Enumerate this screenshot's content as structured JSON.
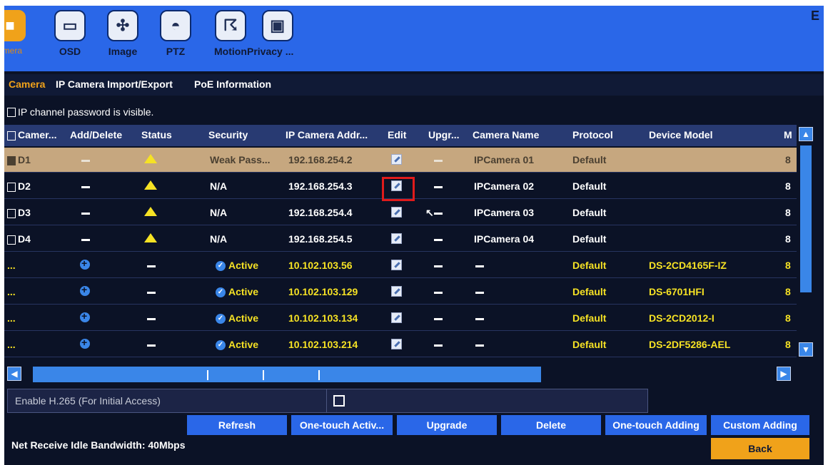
{
  "toolbar": {
    "items": [
      {
        "label": "amera",
        "icon": "camera-icon"
      },
      {
        "label": "OSD",
        "icon": "monitor-icon"
      },
      {
        "label": "Image",
        "icon": "fan-icon"
      },
      {
        "label": "PTZ",
        "icon": "dome-icon"
      },
      {
        "label": "Motion",
        "icon": "running-man-icon"
      },
      {
        "label": "Privacy ...",
        "icon": "privacy-mask-icon"
      }
    ],
    "exit_label": "E"
  },
  "subtabs": [
    "Camera",
    "IP Camera Import/Export",
    "PoE Information"
  ],
  "password_visible_label": "IP channel password is visible.",
  "table": {
    "headers": [
      "Camer...",
      "Add/Delete",
      "Status",
      "Security",
      "IP Camera Addr...",
      "Edit",
      "Upgr...",
      "Camera Name",
      "Protocol",
      "Device Model",
      "M"
    ],
    "rows": [
      {
        "camera": "D1",
        "security": "Weak Pass...",
        "ip": "192.168.254.2",
        "name": "IPCamera 01",
        "protocol": "Default",
        "model": "",
        "m": "8"
      },
      {
        "camera": "D2",
        "security": "N/A",
        "ip": "192.168.254.3",
        "name": "IPCamera 02",
        "protocol": "Default",
        "model": "",
        "m": "8"
      },
      {
        "camera": "D3",
        "security": "N/A",
        "ip": "192.168.254.4",
        "name": "IPCamera 03",
        "protocol": "Default",
        "model": "",
        "m": "8"
      },
      {
        "camera": "D4",
        "security": "N/A",
        "ip": "192.168.254.5",
        "name": "IPCamera 04",
        "protocol": "Default",
        "model": "",
        "m": "8"
      },
      {
        "camera": "...",
        "security": "Active",
        "ip": "10.102.103.56",
        "name": "",
        "protocol": "Default",
        "model": "DS-2CD4165F-IZ",
        "m": "8"
      },
      {
        "camera": "...",
        "security": "Active",
        "ip": "10.102.103.129",
        "name": "",
        "protocol": "Default",
        "model": "DS-6701HFI",
        "m": "8"
      },
      {
        "camera": "...",
        "security": "Active",
        "ip": "10.102.103.134",
        "name": "",
        "protocol": "Default",
        "model": "DS-2CD2012-I",
        "m": "8"
      },
      {
        "camera": "...",
        "security": "Active",
        "ip": "10.102.103.214",
        "name": "",
        "protocol": "Default",
        "model": "DS-2DF5286-AEL",
        "m": "8"
      }
    ]
  },
  "h265_label": "Enable H.265 (For Initial Access)",
  "buttons": {
    "refresh": "Refresh",
    "one_touch_activate": "One-touch Activ...",
    "upgrade": "Upgrade",
    "delete": "Delete",
    "one_touch_adding": "One-touch Adding",
    "custom_adding": "Custom Adding",
    "back": "Back"
  },
  "bandwidth": "Net Receive Idle Bandwidth: 40Mbps",
  "colors": {
    "toolbar": "#2a67e8",
    "active": "#f0a21a",
    "highlight": "#e01b1b",
    "online": "#f6e224"
  }
}
